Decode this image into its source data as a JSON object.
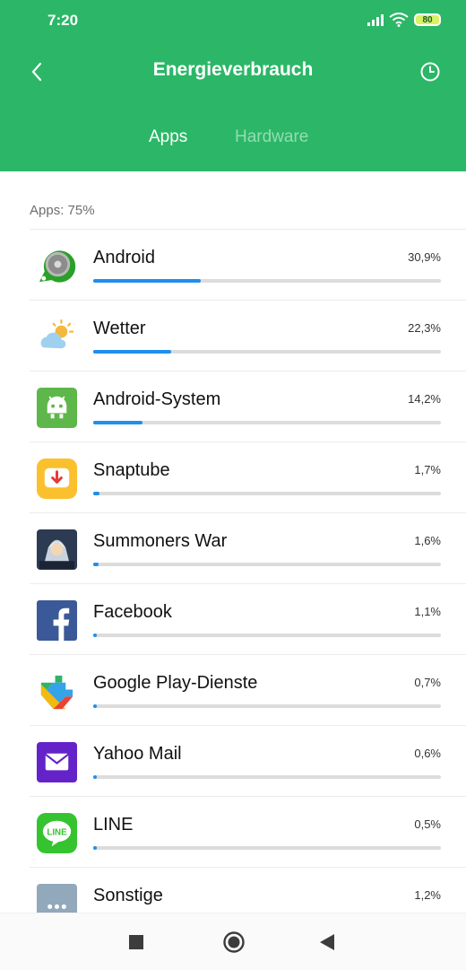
{
  "status": {
    "time": "7:20",
    "battery": "80",
    "icons": [
      "signal-icon",
      "wifi-icon",
      "battery-icon"
    ]
  },
  "header": {
    "title": "Energieverbrauch",
    "back_icon": "back-arrow-icon",
    "history_icon": "clock-icon"
  },
  "tabs": [
    {
      "label": "Apps",
      "active": true
    },
    {
      "label": "Hardware",
      "active": false
    }
  ],
  "section": {
    "label": "Apps: 75%"
  },
  "apps": [
    {
      "name": "Android",
      "percent": "30,9%",
      "value": 30.9,
      "icon": "android-os-icon"
    },
    {
      "name": "Wetter",
      "percent": "22,3%",
      "value": 22.3,
      "icon": "weather-icon"
    },
    {
      "name": "Android-System",
      "percent": "14,2%",
      "value": 14.2,
      "icon": "android-system-icon"
    },
    {
      "name": "Snaptube",
      "percent": "1,7%",
      "value": 1.7,
      "icon": "snaptube-icon"
    },
    {
      "name": "Summoners War",
      "percent": "1,6%",
      "value": 1.6,
      "icon": "summoners-war-icon"
    },
    {
      "name": "Facebook",
      "percent": "1,1%",
      "value": 1.1,
      "icon": "facebook-icon"
    },
    {
      "name": "Google Play-Dienste",
      "percent": "0,7%",
      "value": 0.7,
      "icon": "google-play-services-icon"
    },
    {
      "name": "Yahoo Mail",
      "percent": "0,6%",
      "value": 0.6,
      "icon": "yahoo-mail-icon"
    },
    {
      "name": "LINE",
      "percent": "0,5%",
      "value": 0.5,
      "icon": "line-icon"
    },
    {
      "name": "Sonstige",
      "percent": "1,2%",
      "value": 1.2,
      "icon": "others-icon"
    }
  ],
  "navbar": {
    "icons": [
      "recents-icon",
      "home-icon",
      "back-icon"
    ]
  },
  "colors": {
    "header": "#2bb767",
    "bar": "#1e8ff0",
    "track": "#dcdcdc"
  }
}
